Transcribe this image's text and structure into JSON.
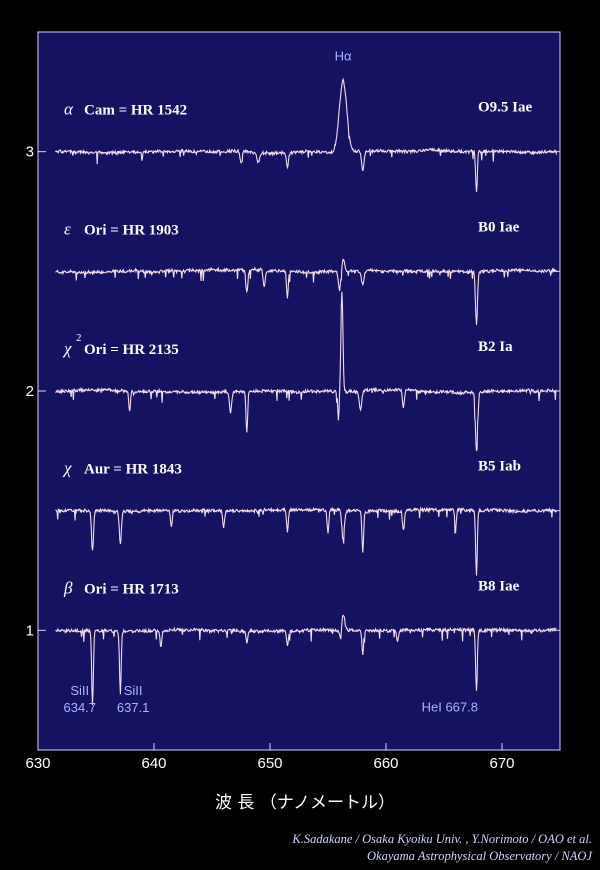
{
  "chart_data": {
    "type": "line",
    "xlabel": "波 長 （ナノメートル）",
    "ylabel": "",
    "xlim": [
      630,
      675
    ],
    "ylim": [
      0.5,
      3.5
    ],
    "xticks": [
      630,
      640,
      650,
      660,
      670
    ],
    "yticks": [
      1,
      2,
      3
    ],
    "background_color": "#151262",
    "line_color": "#f3dde8",
    "label_color": "#a9b3ff",
    "grid": false,
    "series": [
      {
        "star": "α Cam = HR 1542",
        "greek": "α",
        "name_rest": "Cam = HR 1542",
        "spectral_type": "O9.5 Iae",
        "offset": 3.0,
        "lines": [
          [
            656.3,
            0.3,
            0.45
          ],
          [
            667.8,
            -0.17,
            0.1
          ],
          [
            658.0,
            -0.08,
            0.15
          ],
          [
            651.5,
            -0.06,
            0.12
          ],
          [
            649.0,
            -0.04,
            0.15
          ],
          [
            647.5,
            -0.05,
            0.1
          ]
        ]
      },
      {
        "star": "ε Ori = HR 1903",
        "greek": "ε",
        "name_rest": "Ori = HR 1903",
        "spectral_type": "B0 Iae",
        "offset": 2.5,
        "lines": [
          [
            667.8,
            -0.22,
            0.12
          ],
          [
            656.3,
            0.05,
            0.2
          ],
          [
            656.0,
            -0.08,
            0.15
          ],
          [
            651.5,
            -0.11,
            0.1
          ],
          [
            648.0,
            -0.09,
            0.12
          ],
          [
            649.5,
            -0.07,
            0.12
          ],
          [
            658.0,
            -0.06,
            0.15
          ]
        ]
      },
      {
        "star": "χ² Ori = HR 2135",
        "greek": "χ",
        "name_rest": "Ori = HR 2135",
        "superscript": "2",
        "spectral_type": "B2 Ia",
        "offset": 2.0,
        "lines": [
          [
            656.2,
            0.42,
            0.12
          ],
          [
            655.9,
            -0.12,
            0.08
          ],
          [
            667.8,
            -0.25,
            0.12
          ],
          [
            648.0,
            -0.17,
            0.1
          ],
          [
            637.9,
            -0.09,
            0.1
          ],
          [
            646.6,
            -0.09,
            0.12
          ],
          [
            657.8,
            -0.08,
            0.15
          ],
          [
            661.5,
            -0.07,
            0.12
          ]
        ]
      },
      {
        "star": "χ Aur = HR 1843",
        "greek": "χ",
        "name_rest": "Aur = HR 1843",
        "spectral_type": "B5 Iab",
        "offset": 1.5,
        "lines": [
          [
            667.8,
            -0.27,
            0.1
          ],
          [
            634.7,
            -0.17,
            0.12
          ],
          [
            637.1,
            -0.14,
            0.12
          ],
          [
            658.0,
            -0.17,
            0.1
          ],
          [
            656.3,
            -0.12,
            0.15
          ],
          [
            655.0,
            -0.1,
            0.1
          ],
          [
            641.5,
            -0.07,
            0.1
          ],
          [
            646.0,
            -0.07,
            0.1
          ],
          [
            651.5,
            -0.09,
            0.1
          ],
          [
            661.5,
            -0.08,
            0.12
          ],
          [
            666.0,
            -0.07,
            0.1
          ]
        ]
      },
      {
        "star": "β Ori = HR 1713",
        "greek": "β",
        "name_rest": "Ori = HR 1713",
        "spectral_type": "B8 Iae",
        "offset": 1.0,
        "lines": [
          [
            634.7,
            -0.31,
            0.1
          ],
          [
            637.1,
            -0.26,
            0.1
          ],
          [
            667.8,
            -0.26,
            0.1
          ],
          [
            656.3,
            0.07,
            0.2
          ],
          [
            656.1,
            -0.06,
            0.12
          ],
          [
            658.0,
            -0.1,
            0.1
          ],
          [
            640.6,
            -0.07,
            0.1
          ],
          [
            648.0,
            -0.05,
            0.1
          ],
          [
            651.5,
            -0.06,
            0.1
          ],
          [
            661.0,
            -0.05,
            0.1
          ]
        ]
      }
    ],
    "annotations": [
      {
        "text": "Hα",
        "x": 656.3,
        "y": 3.38
      },
      {
        "text": "SiII\n634.7",
        "x": 633.6,
        "y": 0.73
      },
      {
        "text": "SiII\n637.1",
        "x": 638.2,
        "y": 0.73
      },
      {
        "text": "HeI 667.8",
        "x": 665.5,
        "y": 0.66
      }
    ]
  },
  "credits": {
    "line1": "K.Sadakane / Osaka Kyoiku Univ. , Y.Norimoto / OAO et al.",
    "line2": "Okayama Astrophysical Observatory / NAOJ"
  }
}
